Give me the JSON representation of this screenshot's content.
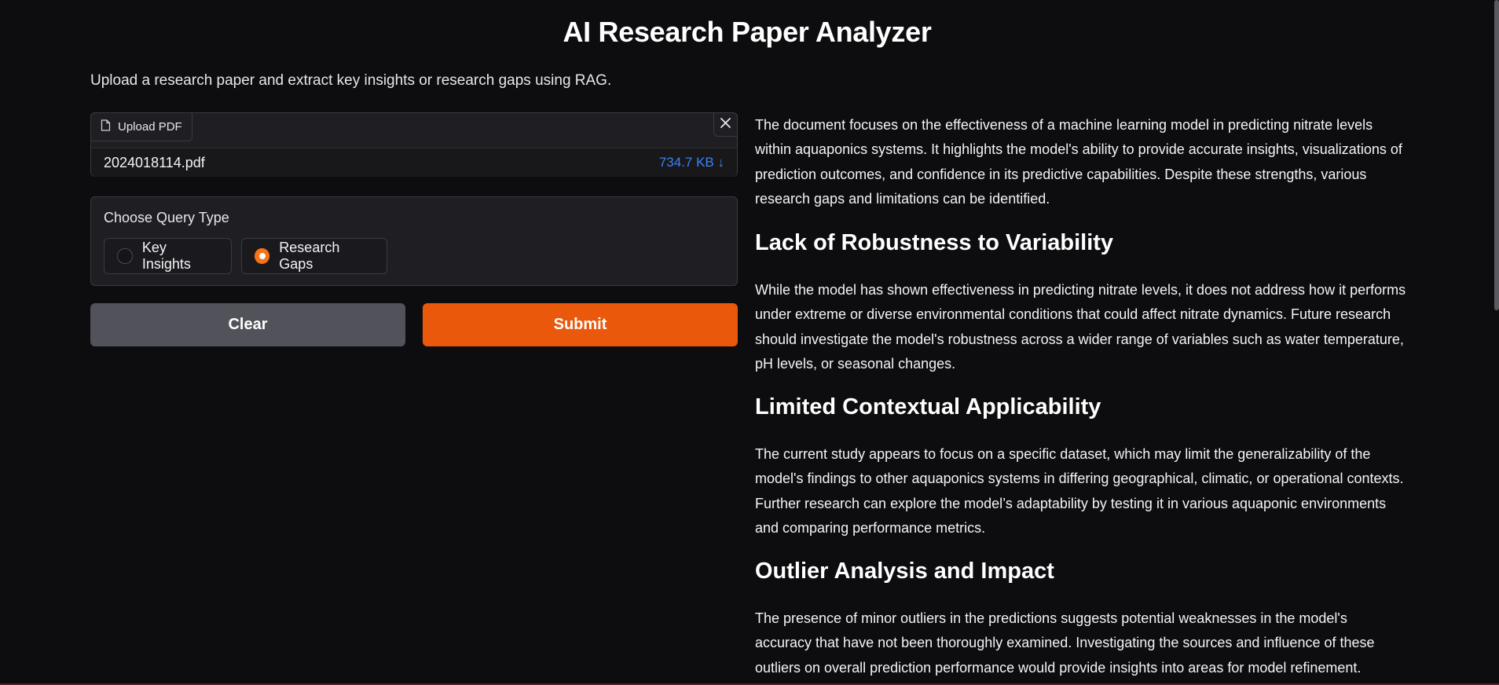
{
  "header": {
    "title": "AI Research Paper Analyzer",
    "subtitle": "Upload a research paper and extract key insights or research gaps using RAG."
  },
  "upload": {
    "label": "Upload PDF",
    "file_name": "2024018114.pdf",
    "file_size": "734.7 KB ↓",
    "icons": [
      "file-icon",
      "close-icon"
    ]
  },
  "query": {
    "label": "Choose Query Type",
    "options": [
      {
        "label": "Key Insights",
        "selected": false
      },
      {
        "label": "Research Gaps",
        "selected": true
      }
    ]
  },
  "buttons": {
    "clear": "Clear",
    "submit": "Submit"
  },
  "output": {
    "intro": "The document focuses on the effectiveness of a machine learning model in predicting nitrate levels within aquaponics systems. It highlights the model's ability to provide accurate insights, visualizations of prediction outcomes, and confidence in its predictive capabilities. Despite these strengths, various research gaps and limitations can be identified.",
    "sections": [
      {
        "heading": "Lack of Robustness to Variability",
        "body": "While the model has shown effectiveness in predicting nitrate levels, it does not address how it performs under extreme or diverse environmental conditions that could affect nitrate dynamics. Future research should investigate the model's robustness across a wider range of variables such as water temperature, pH levels, or seasonal changes."
      },
      {
        "heading": "Limited Contextual Applicability",
        "body": "The current study appears to focus on a specific dataset, which may limit the generalizability of the model's findings to other aquaponics systems in differing geographical, climatic, or operational contexts. Further research can explore the model’s adaptability by testing it in various aquaponic environments and comparing performance metrics."
      },
      {
        "heading": "Outlier Analysis and Impact",
        "body": "The presence of minor outliers in the predictions suggests potential weaknesses in the model's accuracy that have not been thoroughly examined. Investigating the sources and influence of these outliers on overall prediction performance would provide insights into areas for model refinement."
      }
    ]
  },
  "colors": {
    "background": "#0d0d0f",
    "accent": "#ea580c",
    "file_size": "#3b82f6",
    "secondary_button": "#52525b"
  }
}
